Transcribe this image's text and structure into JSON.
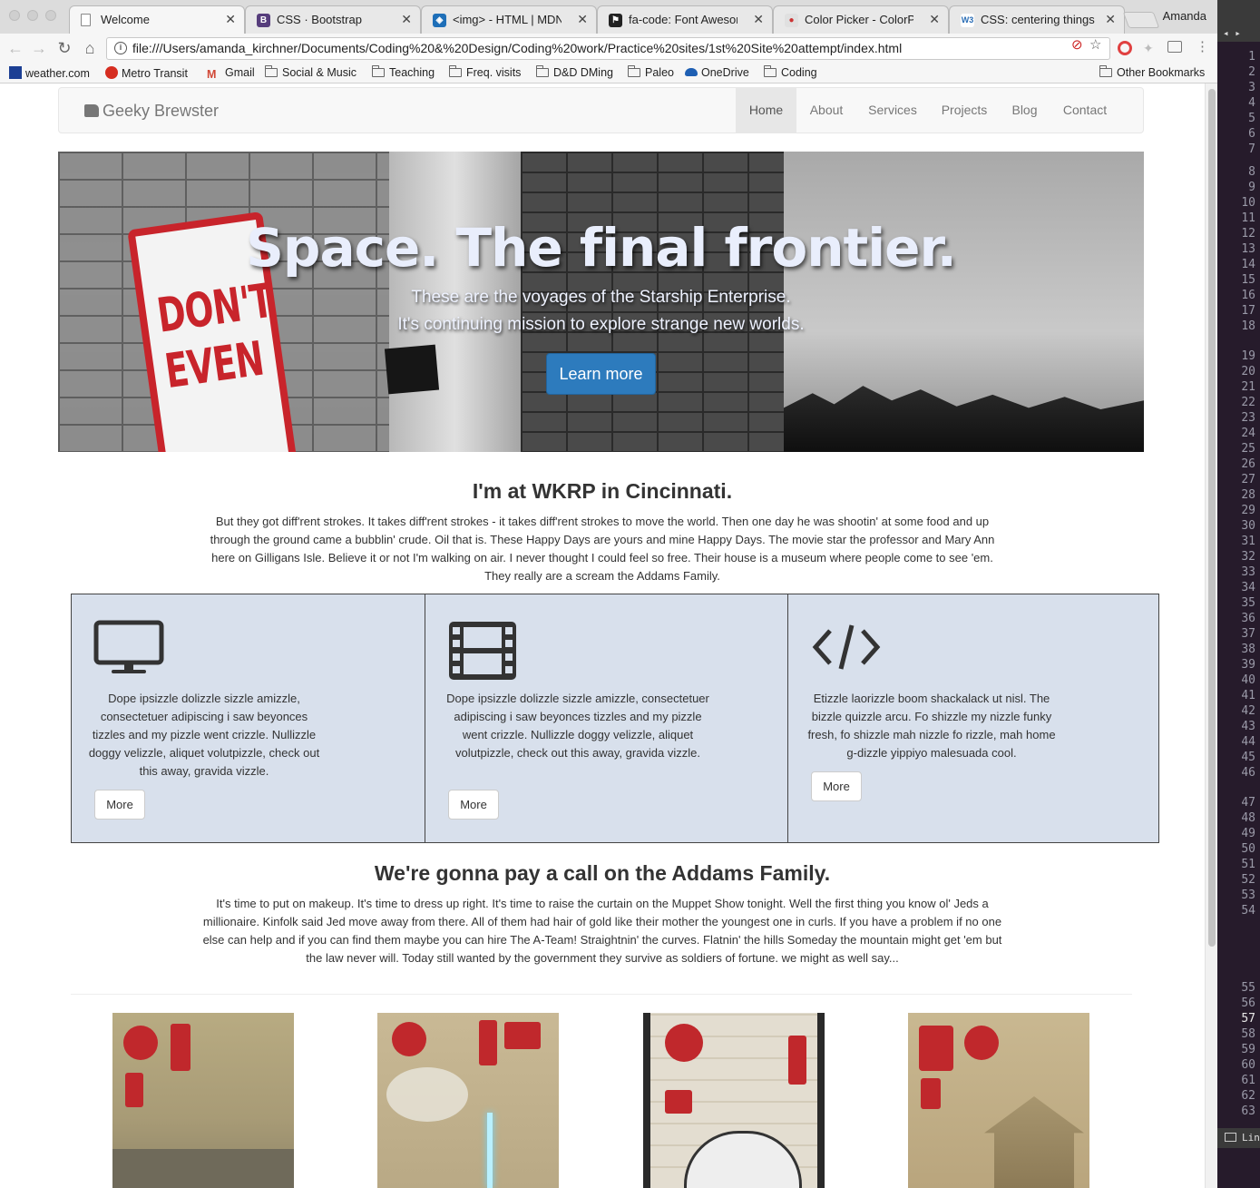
{
  "browser": {
    "tabs": [
      {
        "title": "Welcome",
        "active": true
      },
      {
        "title": "CSS · Bootstrap"
      },
      {
        "title": "<img> - HTML | MDN"
      },
      {
        "title": "fa-code: Font Awesome"
      },
      {
        "title": "Color Picker - ColorPicker"
      },
      {
        "title": "CSS: centering things"
      }
    ],
    "profile": "Amanda",
    "url": "file:///Users/amanda_kirchner/Documents/Coding%20&%20Design/Coding%20work/Practice%20sites/1st%20Site%20attempt/index.html",
    "bookmarks": [
      "weather.com",
      "Metro Transit",
      "Gmail",
      "Social & Music",
      "Teaching",
      "Freq. visits",
      "D&D DMing",
      "Paleo",
      "OneDrive",
      "Coding"
    ],
    "other_bookmarks": "Other Bookmarks"
  },
  "site": {
    "brand": "Geeky Brewster",
    "nav": [
      "Home",
      "About",
      "Services",
      "Projects",
      "Blog",
      "Contact"
    ],
    "hero": {
      "title": "Space. The final frontier.",
      "sub1": "These are the voyages of the Starship Enterprise.",
      "sub2": "It's continuing mission to explore strange new worlds.",
      "button": "Learn more",
      "sign_text": "DON'T EVEN"
    },
    "section1": {
      "title": "I'm at WKRP in Cincinnati.",
      "body": "But they got diff'rent strokes. It takes diff'rent strokes - it takes diff'rent strokes to move the world. Then one day he was shootin' at some food and up through the ground came a bubblin' crude. Oil that is. These Happy Days are yours and mine Happy Days. The movie star the professor and Mary Ann here on Gilligans Isle. Believe it or not I'm walking on air. I never thought I could feel so free. Their house is a museum where people come to see 'em. They really are a scream the Addams Family."
    },
    "features": [
      {
        "icon": "desktop-icon",
        "text": "Dope ipsizzle dolizzle sizzle amizzle, consectetuer adipiscing i saw beyonces tizzles and my pizzle went crizzle. Nullizzle doggy velizzle, aliquet volutpizzle, check out this away, gravida vizzle.",
        "button": "More"
      },
      {
        "icon": "film-icon",
        "text": "Dope ipsizzle dolizzle sizzle amizzle, consectetuer adipiscing i saw beyonces tizzles and my pizzle went crizzle. Nullizzle doggy velizzle, aliquet volutpizzle, check out this away, gravida vizzle.",
        "button": "More"
      },
      {
        "icon": "code-icon",
        "text": "Etizzle laorizzle boom shackalack ut nisl. The bizzle quizzle arcu. Fo shizzle my nizzle funky fresh, fo shizzle mah nizzle fo rizzle, mah home g-dizzle yippiyo malesuada cool.",
        "button": "More"
      }
    ],
    "section2": {
      "title": "We're gonna pay a call on the Addams Family.",
      "body": "It's time to put on makeup. It's time to dress up right. It's time to raise the curtain on the Muppet Show tonight. Well the first thing you know ol' Jeds a millionaire. Kinfolk said Jed move away from there. All of them had hair of gold like their mother the youngest one in curls. If you have a problem if no one else can help and if you can find them maybe you can hire The A-Team! Straightnin' the curves. Flatnin' the hills Someday the mountain might get 'em but the law never will. Today still wanted by the government they survive as soldiers of fortune. we might as well say..."
    },
    "colors": {
      "feature_bg": "#d8e0ec",
      "hero_button": "#2d7bbd",
      "stamp_red": "#c0282c"
    }
  },
  "editor": {
    "line_numbers": [
      "1",
      "2",
      "3",
      "4",
      "5",
      "6",
      "7",
      "8",
      "9",
      "10",
      "11",
      "12",
      "13",
      "14",
      "15",
      "16",
      "17",
      "18",
      "19",
      "20",
      "21",
      "22",
      "23",
      "24",
      "25",
      "26",
      "27",
      "28",
      "29",
      "30",
      "31",
      "32",
      "33",
      "34",
      "35",
      "36",
      "37",
      "38",
      "39",
      "40",
      "41",
      "42",
      "43",
      "44",
      "45",
      "46",
      "47",
      "48",
      "49",
      "50",
      "51",
      "52",
      "53",
      "54",
      "55",
      "56",
      "57",
      "58",
      "59",
      "60",
      "61",
      "62",
      "63"
    ],
    "current_line": "57",
    "status": "Line"
  }
}
